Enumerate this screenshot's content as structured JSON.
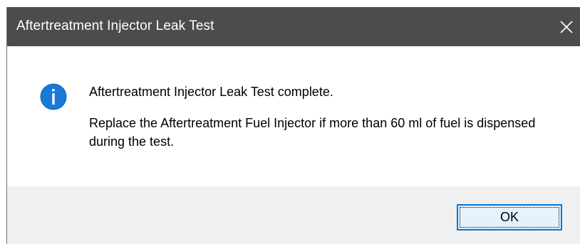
{
  "window": {
    "title": "Aftertreatment Injector Leak Test",
    "close_icon": "close-icon",
    "titlebar_color": "#4c4c4c"
  },
  "message": {
    "icon": "info-icon",
    "icon_color": "#0a6fd0",
    "line1": "Aftertreatment Injector Leak Test complete.",
    "line2": "Replace the Aftertreatment Fuel Injector if more than 60 ml of fuel is dispensed during the test."
  },
  "buttons": {
    "ok_label": "OK",
    "accent": "#0078d7"
  }
}
